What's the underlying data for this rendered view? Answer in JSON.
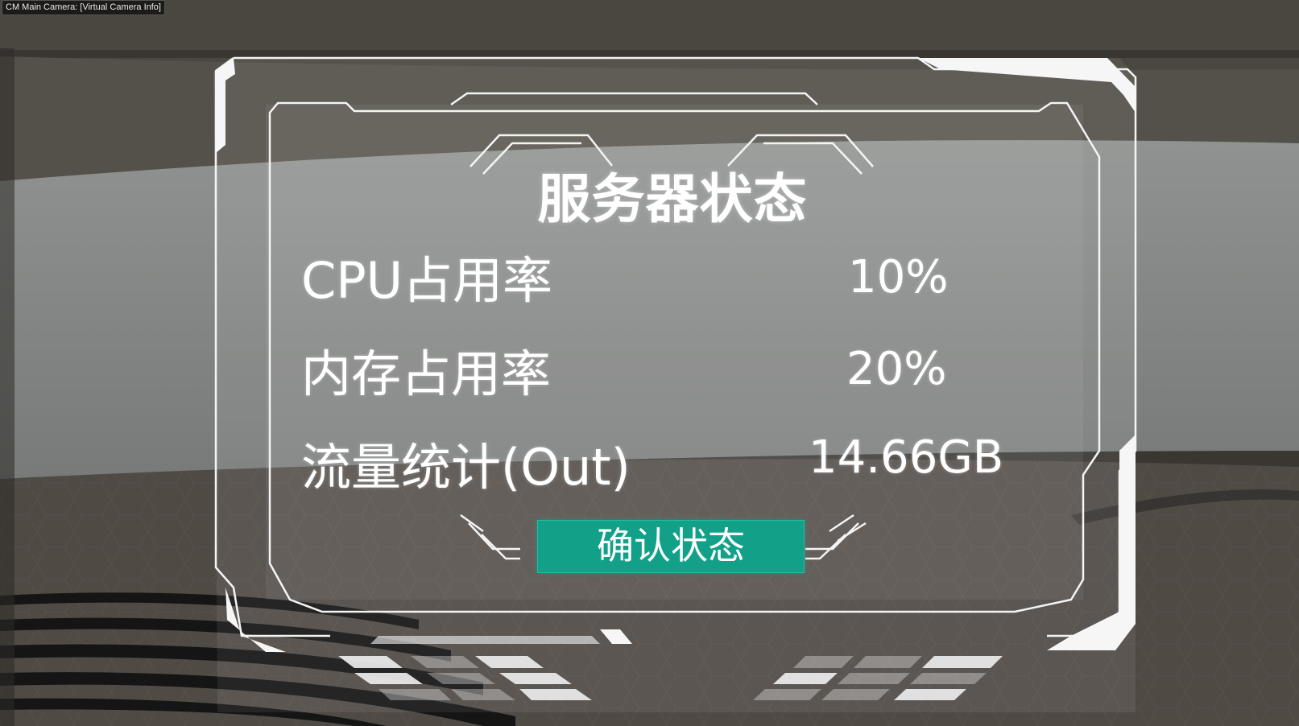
{
  "camera_label": "CM Main Camera: [Virtual Camera Info]",
  "panel": {
    "title": "服务器状态",
    "stats": [
      {
        "label": "CPU占用率",
        "value": "10%"
      },
      {
        "label": "内存占用率",
        "value": "20%"
      },
      {
        "label": "流量统计(Out)",
        "value": "14.66GB"
      }
    ],
    "confirm_label": "确认状态"
  },
  "colors": {
    "accent": "#12a088",
    "frame": "#f2f2f2",
    "text": "#ffffff"
  }
}
